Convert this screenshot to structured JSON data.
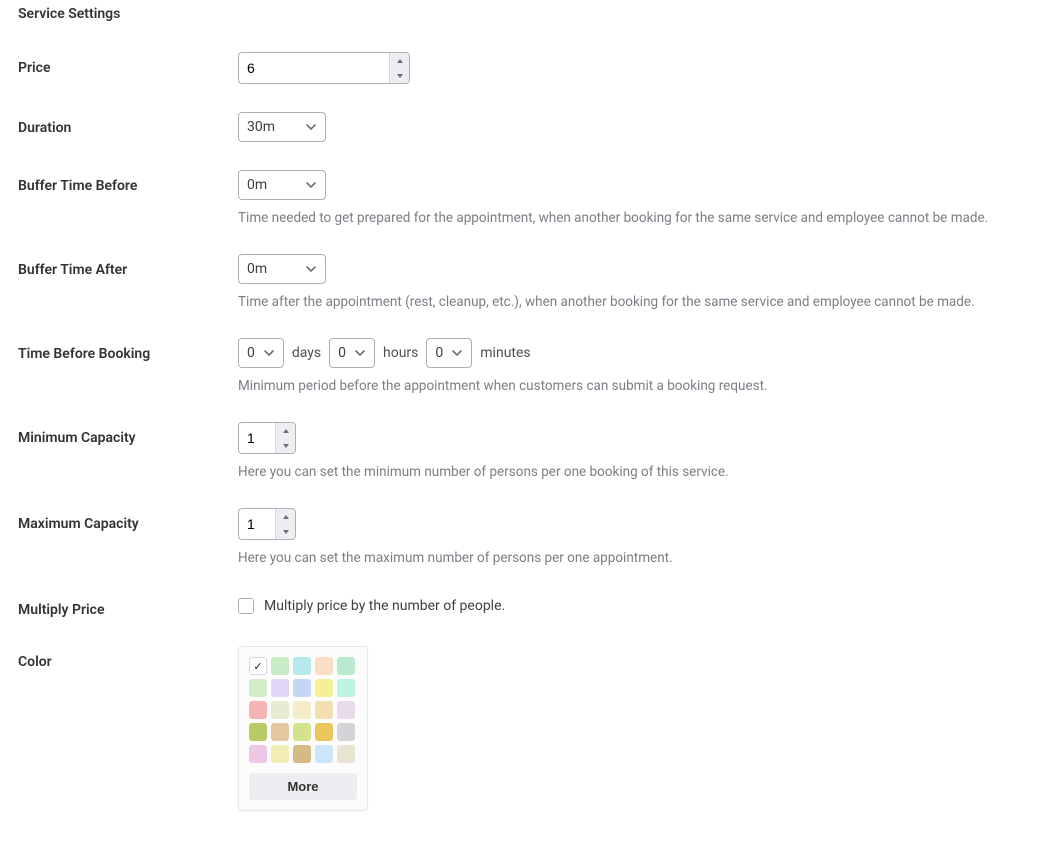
{
  "section_title": "Service Settings",
  "price": {
    "label": "Price",
    "value": "6"
  },
  "duration": {
    "label": "Duration",
    "value": "30m"
  },
  "buffer_before": {
    "label": "Buffer Time Before",
    "value": "0m",
    "help": "Time needed to get prepared for the appointment, when another booking for the same service and employee cannot be made."
  },
  "buffer_after": {
    "label": "Buffer Time After",
    "value": "0m",
    "help": "Time after the appointment (rest, cleanup, etc.), when another booking for the same service and employee cannot be made."
  },
  "time_before": {
    "label": "Time Before Booking",
    "days": "0",
    "days_unit": "days",
    "hours": "0",
    "hours_unit": "hours",
    "minutes": "0",
    "minutes_unit": "minutes",
    "help": "Minimum period before the appointment when customers can submit a booking request."
  },
  "min_capacity": {
    "label": "Minimum Capacity",
    "value": "1",
    "help": "Here you can set the minimum number of persons per one booking of this service."
  },
  "max_capacity": {
    "label": "Maximum Capacity",
    "value": "1",
    "help": "Here you can set the maximum number of persons per one appointment."
  },
  "multiply": {
    "label": "Multiply Price",
    "checkbox_label": "Multiply price by the number of people.",
    "checked": false
  },
  "color": {
    "label": "Color",
    "more": "More",
    "selected_index": 0,
    "swatches": [
      "#ffffff",
      "#c8ebc5",
      "#b5e9ee",
      "#fadfc4",
      "#b9ead0",
      "#d3eec7",
      "#e0d6f6",
      "#c5d5f6",
      "#f3f193",
      "#bef4e0",
      "#f4b4b4",
      "#e6ecd1",
      "#f5ecc8",
      "#f2dfaf",
      "#e9dbe9",
      "#b6cb66",
      "#e6c8a0",
      "#d2e28d",
      "#eac559",
      "#d4d4d8",
      "#edc7e5",
      "#f2eeb3",
      "#d4ba85",
      "#cbe6fa",
      "#e9e3d2"
    ]
  }
}
